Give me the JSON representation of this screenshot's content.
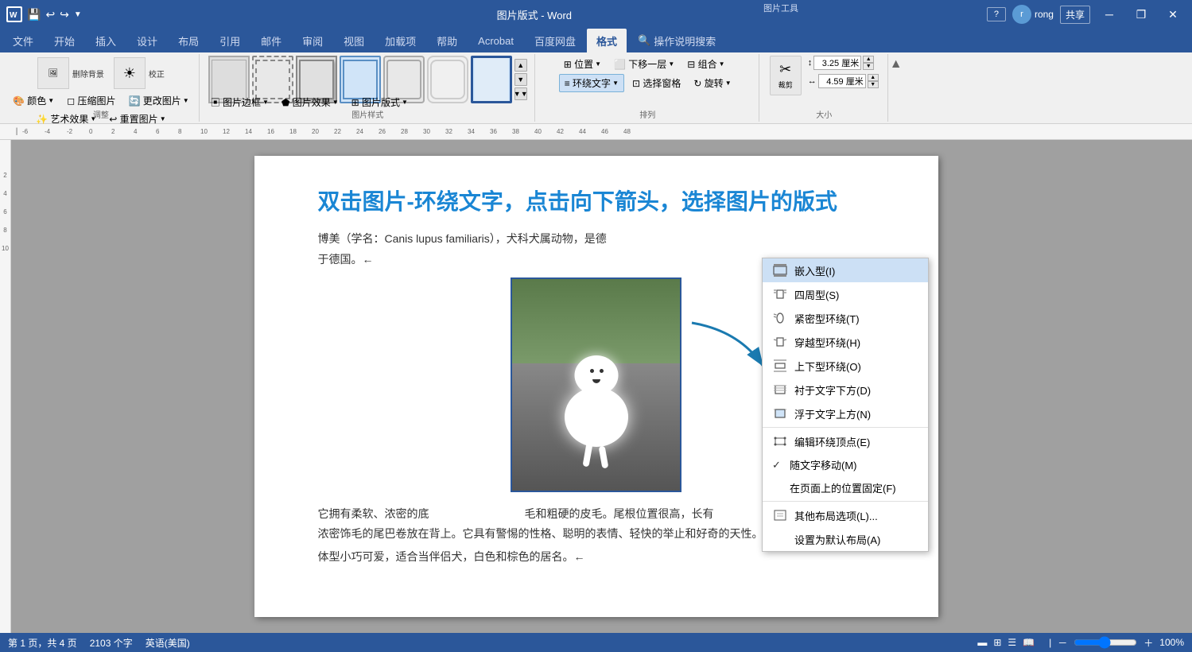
{
  "titleBar": {
    "title": "图片版式 - Word",
    "toolsLabel": "图片工具",
    "userName": "rong",
    "winBtns": [
      "─",
      "❐",
      "✕"
    ]
  },
  "ribbonTabs": [
    {
      "label": "文件",
      "active": false
    },
    {
      "label": "开始",
      "active": false
    },
    {
      "label": "插入",
      "active": false
    },
    {
      "label": "设计",
      "active": false
    },
    {
      "label": "布局",
      "active": false
    },
    {
      "label": "引用",
      "active": false
    },
    {
      "label": "邮件",
      "active": false
    },
    {
      "label": "审阅",
      "active": false
    },
    {
      "label": "视图",
      "active": false
    },
    {
      "label": "加载项",
      "active": false
    },
    {
      "label": "帮助",
      "active": false
    },
    {
      "label": "Acrobat",
      "active": false
    },
    {
      "label": "百度网盘",
      "active": false
    },
    {
      "label": "格式",
      "active": true
    },
    {
      "label": "操作说明搜索",
      "active": false
    }
  ],
  "pictureTools": {
    "adjust": {
      "label": "调整",
      "buttons": [
        {
          "label": "删除背景",
          "icon": "🖼"
        },
        {
          "label": "校正",
          "icon": "☀"
        },
        {
          "label": "颜色▼",
          "icon": "🎨"
        },
        {
          "label": "艺术效果▼",
          "icon": "✨"
        },
        {
          "label": "压缩图片",
          "icon": "◻"
        },
        {
          "label": "更改图片▼",
          "icon": "🔄"
        },
        {
          "label": "重置图片▼",
          "icon": "↩"
        }
      ]
    },
    "pictureStyles": {
      "label": "图片样式",
      "thumbnails": 7
    },
    "arrange": {
      "label": "排列",
      "buttons": [
        {
          "label": "图片边框▼"
        },
        {
          "label": "图片效果▼"
        },
        {
          "label": "图片版式▼"
        },
        {
          "label": "位置▼"
        },
        {
          "label": "环绕文字▼"
        },
        {
          "label": "下移一层▼"
        },
        {
          "label": "选择窗格"
        },
        {
          "label": "旋转▼"
        },
        {
          "label": "组合▼"
        }
      ]
    },
    "size": {
      "label": "大小",
      "height": "3.25 厘米",
      "width": "4.59 厘米"
    }
  },
  "wrapMenu": {
    "items": [
      {
        "label": "嵌入型(I)",
        "icon": "inline",
        "shortcut": "",
        "highlighted": true,
        "checked": false
      },
      {
        "label": "四周型(S)",
        "icon": "square",
        "shortcut": "",
        "highlighted": false,
        "checked": false
      },
      {
        "label": "紧密型环绕(T)",
        "icon": "tight",
        "shortcut": "",
        "highlighted": false,
        "checked": false
      },
      {
        "label": "穿越型环绕(H)",
        "icon": "through",
        "shortcut": "",
        "highlighted": false,
        "checked": false
      },
      {
        "label": "上下型环绕(O)",
        "icon": "topbottom",
        "shortcut": "",
        "highlighted": false,
        "checked": false
      },
      {
        "label": "衬于文字下方(D)",
        "icon": "behind",
        "shortcut": "",
        "highlighted": false,
        "checked": false
      },
      {
        "label": "浮于文字上方(N)",
        "icon": "infront",
        "shortcut": "",
        "highlighted": false,
        "checked": false
      },
      {
        "divider": true
      },
      {
        "label": "编辑环绕顶点(E)",
        "icon": "edit",
        "shortcut": "",
        "highlighted": false,
        "checked": false
      },
      {
        "label": "随文字移动(M)",
        "icon": "move",
        "shortcut": "",
        "highlighted": false,
        "checked": true
      },
      {
        "label": "在页面上的位置固定(F)",
        "icon": "fixed",
        "shortcut": "",
        "highlighted": false,
        "checked": false
      },
      {
        "divider": true
      },
      {
        "label": "其他布局选项(L)...",
        "icon": "more",
        "shortcut": "",
        "highlighted": false,
        "checked": false
      },
      {
        "label": "设置为默认布局(A)",
        "icon": "default",
        "shortcut": "",
        "highlighted": false,
        "checked": false
      }
    ]
  },
  "document": {
    "heading": "双击图片-环绕文字，点击向下箭头，选择图片的版式",
    "para1": "博美（学名：Canis lupus familiaris），犬科犬属动物，是德\n于德国。←",
    "para2": "它拥有柔软、浓密的底                    毛和粗硬的皮毛。尾根位置很高，长有\n浓密饰毛的尾巴卷放在背上。它具有警惕的性格、聪明的表情、轻快的举止和好奇的天性。",
    "para3": "体型小巧可爱，适合当伴侣犬，白色和棕色的居名。←"
  },
  "statusBar": {
    "page": "第 1 页，共 4 页",
    "words": "2103 个字",
    "lang": "英语(美国)",
    "zoom": "100%"
  },
  "ruler": {
    "marks": [
      "-6",
      "-4",
      "-2",
      "0",
      "2",
      "4",
      "6",
      "8",
      "10",
      "12",
      "14",
      "16",
      "18",
      "20",
      "22",
      "24",
      "26",
      "28",
      "30",
      "32",
      "34",
      "36",
      "38",
      "40",
      "42",
      "44",
      "46",
      "48"
    ]
  },
  "share": "共享"
}
